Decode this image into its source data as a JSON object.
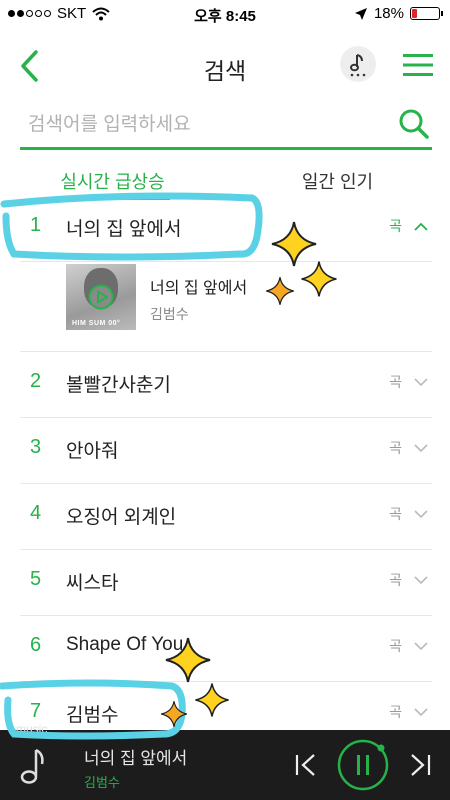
{
  "status": {
    "carrier": "SKT",
    "time": "오후 8:45",
    "battery": "18%",
    "battery_level": 0.18
  },
  "header": {
    "title": "검색",
    "back_icon": "chevron-left-icon",
    "music_icon": "music-note-icon",
    "menu_icon": "hamburger-menu-icon"
  },
  "search": {
    "placeholder": "검색어를 입력하세요",
    "icon": "search-icon"
  },
  "tabs": [
    {
      "label": "실시간 급상승",
      "active": true
    },
    {
      "label": "일간 인기",
      "active": false
    }
  ],
  "ranking": [
    {
      "rank": "1",
      "keyword": "너의 집 앞에서",
      "type": "곡",
      "expanded": true
    },
    {
      "rank": "2",
      "keyword": "볼빨간사춘기",
      "type": "곡"
    },
    {
      "rank": "3",
      "keyword": "안아줘",
      "type": "곡"
    },
    {
      "rank": "4",
      "keyword": "오징어 외계인",
      "type": "곡"
    },
    {
      "rank": "5",
      "keyword": "씨스타",
      "type": "곡"
    },
    {
      "rank": "6",
      "keyword": "Shape Of You",
      "type": "곡"
    },
    {
      "rank": "7",
      "keyword": "김범수",
      "type": "곡"
    }
  ],
  "expanded_item": {
    "title": "너의 집 앞에서",
    "artist": "김범수",
    "album_art_text": "HIM SUM 00°"
  },
  "player": {
    "label": "music",
    "title": "너의 집 앞에서",
    "artist": "김범수"
  },
  "colors": {
    "accent": "#27b24a",
    "player_bg": "#1c1c1c",
    "annotation": "#5bd1e6",
    "sparkle": "#ffd21f"
  }
}
